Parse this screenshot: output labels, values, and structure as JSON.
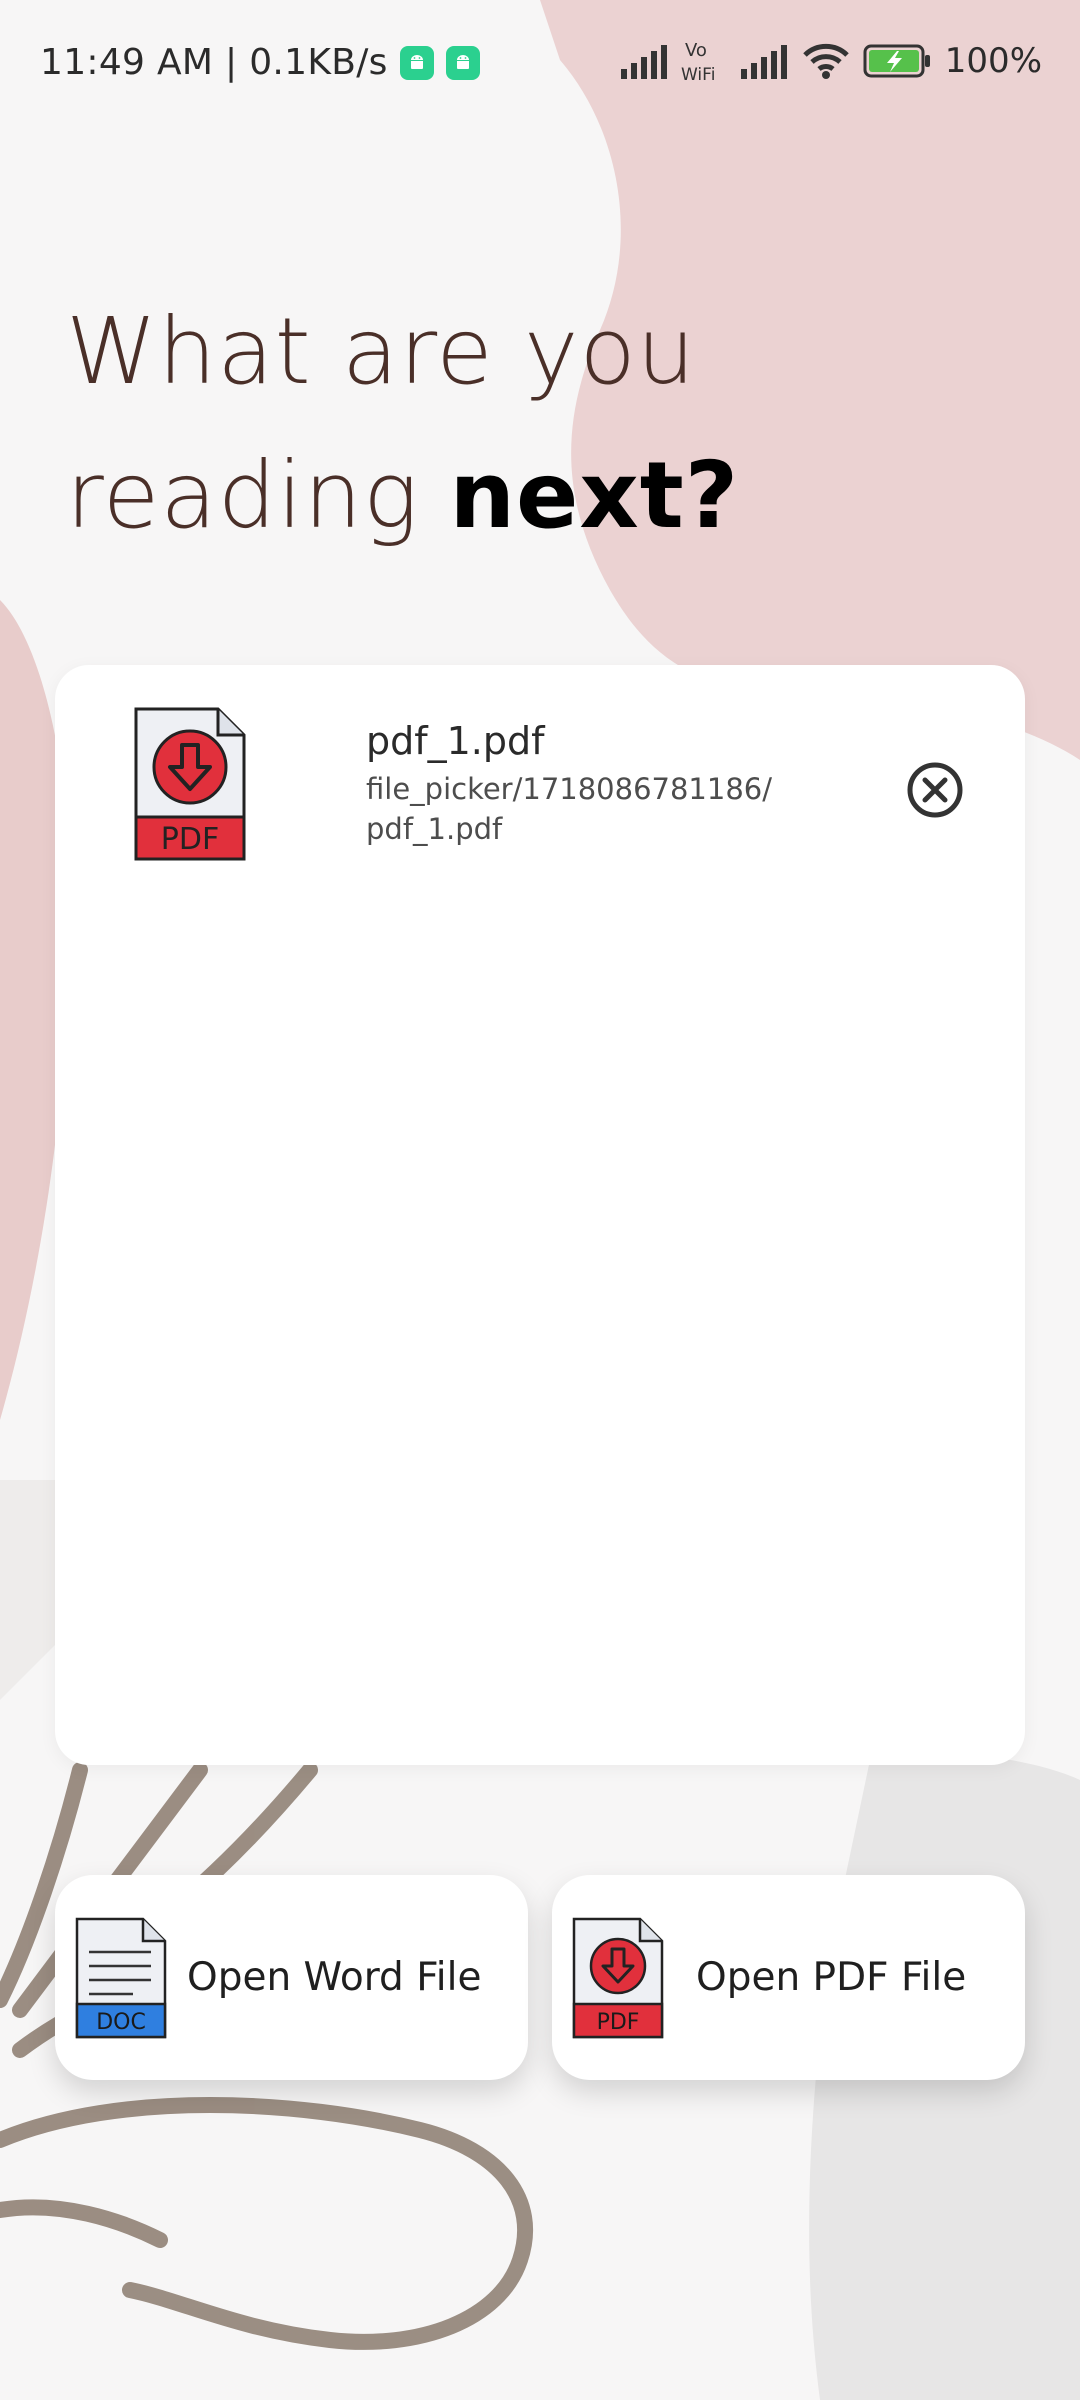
{
  "status_bar": {
    "time_speed": "11:49 AM | 0.1KB/s",
    "vowifi_top": "Vo",
    "vowifi_bottom": "WiFi",
    "battery_text": "100%"
  },
  "headline": {
    "line1": "What are you",
    "line2_regular": "reading ",
    "line2_bold": "next?"
  },
  "file_list": {
    "items": [
      {
        "name": "pdf_1.pdf",
        "path": "file_picker/1718086781186/pdf_1.pdf",
        "icon": "pdf-file-icon",
        "icon_tag": "PDF"
      }
    ]
  },
  "actions": {
    "open_word": {
      "label": "Open Word File",
      "icon": "doc-file-icon",
      "icon_tag": "DOC"
    },
    "open_pdf": {
      "label": "Open PDF File",
      "icon": "pdf-file-icon",
      "icon_tag": "PDF"
    }
  },
  "colors": {
    "headline": "#4a2f28",
    "pink_blob": "#ead0d0",
    "stroke": "#8b7b6e",
    "pdf_red": "#e1303c",
    "doc_blue": "#2f7fe0",
    "android_green": "#2bd08f"
  }
}
